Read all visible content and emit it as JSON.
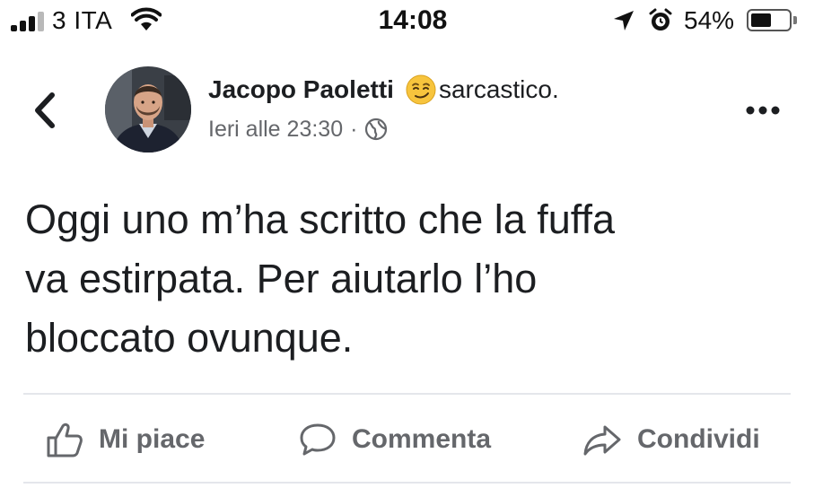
{
  "status_bar": {
    "carrier": "3 ITA",
    "time": "14:08",
    "battery_percent": "54%",
    "battery_level": 0.54,
    "icons": [
      "signal-icon",
      "wifi-icon",
      "location-arrow-icon",
      "alarm-icon",
      "battery-icon"
    ]
  },
  "post": {
    "author": "Jacopo Paoletti",
    "feeling": "sarcastico.",
    "feeling_icon": "smirk-emoji-icon",
    "timestamp": "Ieri alle 23:30",
    "separator": "·",
    "privacy_icon": "globe-icon",
    "text": "Oggi uno m’ha scritto che la fuffa\nva estirpata. Per aiutarlo l’ho\nbloccato ovunque."
  },
  "actions": {
    "like_label": "Mi piace",
    "comment_label": "Commenta",
    "share_label": "Condividi"
  },
  "colors": {
    "text_primary": "#1c1e21",
    "text_secondary": "#65676b",
    "divider": "#e4e6eb",
    "emoji": "#f7c43d"
  }
}
